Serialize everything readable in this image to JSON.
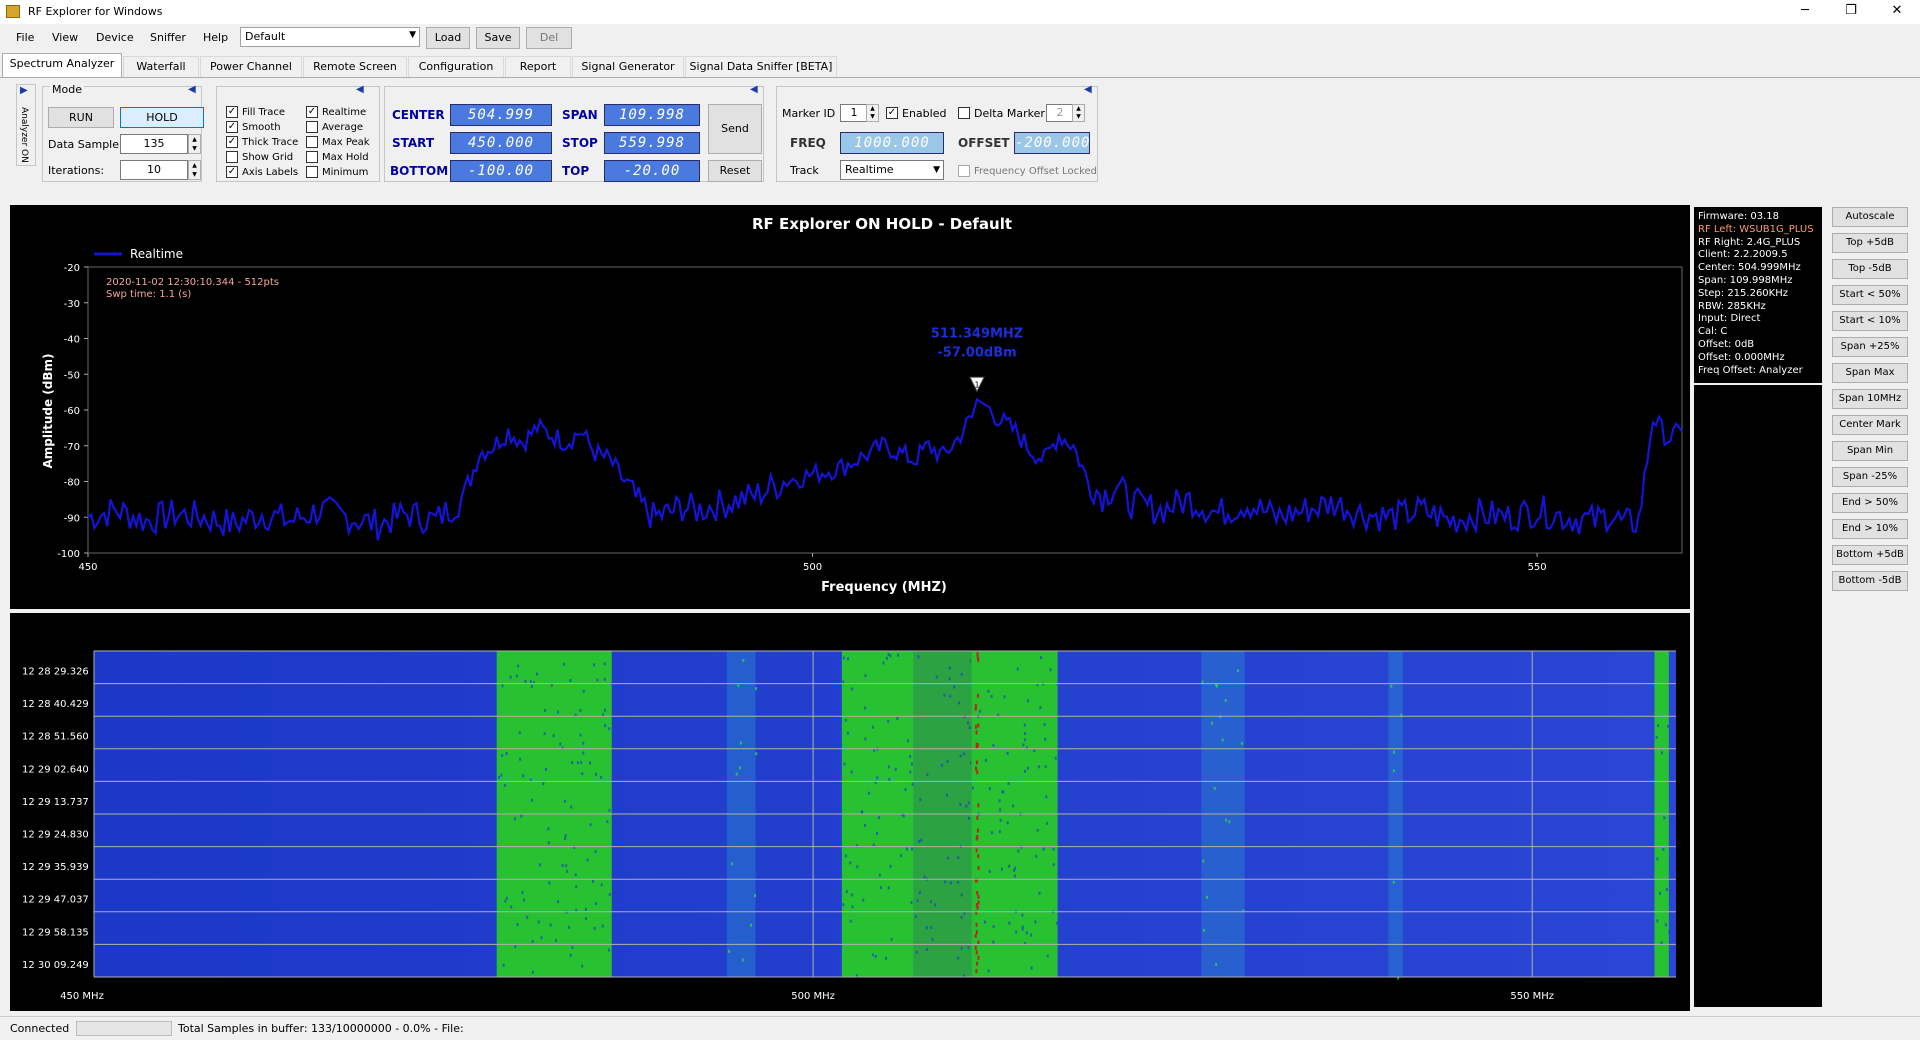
{
  "window": {
    "title": "RF Explorer for Windows",
    "minimize": "─",
    "maximize": "❐",
    "close": "✕"
  },
  "menu": [
    "File",
    "View",
    "Device",
    "Sniffer",
    "Help"
  ],
  "config": {
    "selected": "Default",
    "load": "Load",
    "save": "Save",
    "del": "Del"
  },
  "tabs": [
    "Spectrum Analyzer",
    "Waterfall",
    "Power Channel",
    "Remote Screen",
    "Configuration",
    "Report",
    "Signal Generator",
    "Signal Data Sniffer [BETA]"
  ],
  "analyzer_label": "Analyzer ON",
  "mode": {
    "group_title": "Mode",
    "run": "RUN",
    "hold": "HOLD",
    "data_sample_label": "Data Sample:",
    "data_sample": "135",
    "iterations_label": "Iterations:",
    "iterations": "10"
  },
  "trace_options": [
    {
      "label": "Fill Trace",
      "checked": true
    },
    {
      "label": "Smooth",
      "checked": true
    },
    {
      "label": "Thick Trace",
      "checked": true
    },
    {
      "label": "Show Grid",
      "checked": false
    },
    {
      "label": "Axis Labels",
      "checked": true
    }
  ],
  "trace_modes": [
    {
      "label": "Realtime",
      "checked": true
    },
    {
      "label": "Average",
      "checked": false
    },
    {
      "label": "Max Peak",
      "checked": false
    },
    {
      "label": "Max Hold",
      "checked": false
    },
    {
      "label": "Minimum",
      "checked": false
    }
  ],
  "freq": {
    "center_label": "CENTER",
    "center": "504.999",
    "span_label": "SPAN",
    "span": "109.998",
    "start_label": "START",
    "start": "450.000",
    "stop_label": "STOP",
    "stop": "559.998",
    "bottom_label": "BOTTOM",
    "bottom": "-100.00",
    "top_label": "TOP",
    "top": "-20.00",
    "send": "Send",
    "reset": "Reset"
  },
  "marker": {
    "id_label": "Marker ID",
    "id": "1",
    "enabled_label": "Enabled",
    "enabled": true,
    "delta_label": "Delta Marker",
    "delta": false,
    "delta_id": "2",
    "freq_label": "FREQ",
    "freq": "1000.000",
    "offset_label": "OFFSET",
    "offset": "-200.000",
    "track_label": "Track",
    "track": "Realtime",
    "offset_locked_label": "Frequency Offset Locked"
  },
  "chart_data": {
    "type": "line",
    "title": "RF Explorer ON HOLD - Default",
    "xlabel": "Frequency (MHZ)",
    "ylabel": "Amplitude (dBm)",
    "xlim": [
      450,
      559.998
    ],
    "ylim": [
      -100,
      -20
    ],
    "xticks": [
      "450",
      "500",
      "550"
    ],
    "yticks": [
      "-20",
      "-30",
      "-40",
      "-50",
      "-60",
      "-70",
      "-80",
      "-90",
      "-100"
    ],
    "legend": "Realtime",
    "legend_position": "top-left",
    "timestamp": "2020-11-02 12:30:10.344 - 512pts",
    "sweep_time": "Swp time: 1.1 (s)",
    "marker_freq": "511.349MHZ",
    "marker_amp": "-57.00dBm",
    "marker_x": 511.349,
    "marker_y": -57.0,
    "series": [
      {
        "name": "Realtime",
        "color": "#1414d8",
        "x": [
          450,
          452,
          454,
          456,
          458,
          460,
          462,
          464,
          466,
          468,
          470,
          472,
          474,
          476,
          477,
          478,
          479,
          480,
          481,
          482,
          483,
          484,
          485,
          486,
          487,
          488,
          489,
          490,
          491,
          492,
          494,
          496,
          498,
          500,
          502,
          504,
          505,
          506,
          507,
          508,
          509,
          510,
          511,
          511.35,
          512,
          513,
          514,
          515,
          516,
          517,
          518,
          519,
          520,
          521,
          522,
          524,
          526,
          528,
          530,
          532,
          534,
          536,
          538,
          540,
          542,
          544,
          546,
          548,
          550,
          552,
          554,
          555,
          556,
          557,
          558,
          559,
          560
        ],
        "y": [
          -90,
          -88,
          -91,
          -89,
          -90,
          -92,
          -89,
          -91,
          -88,
          -90,
          -92,
          -89,
          -91,
          -84,
          -72,
          -70,
          -66,
          -69,
          -65,
          -67,
          -69,
          -66,
          -72,
          -74,
          -80,
          -86,
          -90,
          -89,
          -87,
          -88,
          -86,
          -84,
          -80,
          -78,
          -76,
          -72,
          -70,
          -72,
          -74,
          -70,
          -73,
          -68,
          -62,
          -57,
          -59,
          -63,
          -66,
          -71,
          -74,
          -67,
          -70,
          -80,
          -84,
          -81,
          -86,
          -88,
          -85,
          -89,
          -86,
          -90,
          -88,
          -86,
          -89,
          -90,
          -88,
          -91,
          -89,
          -90,
          -88,
          -90,
          -91,
          -89,
          -92,
          -91,
          -62,
          -68,
          -66
        ]
      }
    ]
  },
  "waterfall": {
    "times": [
      "12 28 29.326",
      "12 28 40.429",
      "12 28 51.560",
      "12 29 02.640",
      "12 29 13.737",
      "12 29 24.830",
      "12 29 35.939",
      "12 29 47.037",
      "12 29 58.135",
      "12 30 09.249"
    ],
    "xticks": [
      "450 MHz",
      "500 MHz",
      "550 MHz"
    ],
    "bands": [
      {
        "start": 478,
        "end": 486,
        "level": "strong"
      },
      {
        "start": 502,
        "end": 507,
        "level": "strong"
      },
      {
        "start": 507,
        "end": 511,
        "level": "medium"
      },
      {
        "start": 511,
        "end": 517,
        "level": "strong"
      },
      {
        "start": 494,
        "end": 496,
        "level": "weak"
      },
      {
        "start": 527,
        "end": 530,
        "level": "weak"
      },
      {
        "start": 540,
        "end": 541,
        "level": "weak"
      },
      {
        "start": 558.5,
        "end": 559.5,
        "level": "strong"
      }
    ],
    "peak_line_mhz": 511.3
  },
  "info": [
    {
      "text": "Firmware: 03.18",
      "color": "#ffffff"
    },
    {
      "text": "RF Left: WSUB1G_PLUS",
      "color": "#ff9966"
    },
    {
      "text": "RF Right: 2.4G_PLUS",
      "color": "#ffffff"
    },
    {
      "text": "Client: 2.2.2009.5",
      "color": "#ffffff"
    },
    {
      "text": "Center: 504.999MHz",
      "color": "#ffffff"
    },
    {
      "text": "Span: 109.998MHz",
      "color": "#ffffff"
    },
    {
      "text": "Step: 215.260KHz",
      "color": "#ffffff"
    },
    {
      "text": "RBW: 285KHz",
      "color": "#ffffff"
    },
    {
      "text": "Input: Direct",
      "color": "#ffffff"
    },
    {
      "text": "Cal: C",
      "color": "#ffffff"
    },
    {
      "text": "Offset: 0dB",
      "color": "#ffffff"
    },
    {
      "text": "Offset: 0.000MHz",
      "color": "#ffffff"
    },
    {
      "text": "Freq Offset: Analyzer",
      "color": "#ffffff"
    }
  ],
  "right_buttons": [
    "Autoscale",
    "Top +5dB",
    "Top -5dB",
    "Start < 50%",
    "Start < 10%",
    "Span +25%",
    "Span Max",
    "Span 10MHz",
    "Center Mark",
    "Span Min",
    "Span -25%",
    "End > 50%",
    "End > 10%",
    "Bottom +5dB",
    "Bottom -5dB"
  ],
  "status": {
    "connected": "Connected",
    "samples": "Total Samples in buffer: 133/10000000 - 0.0%   - File:"
  }
}
